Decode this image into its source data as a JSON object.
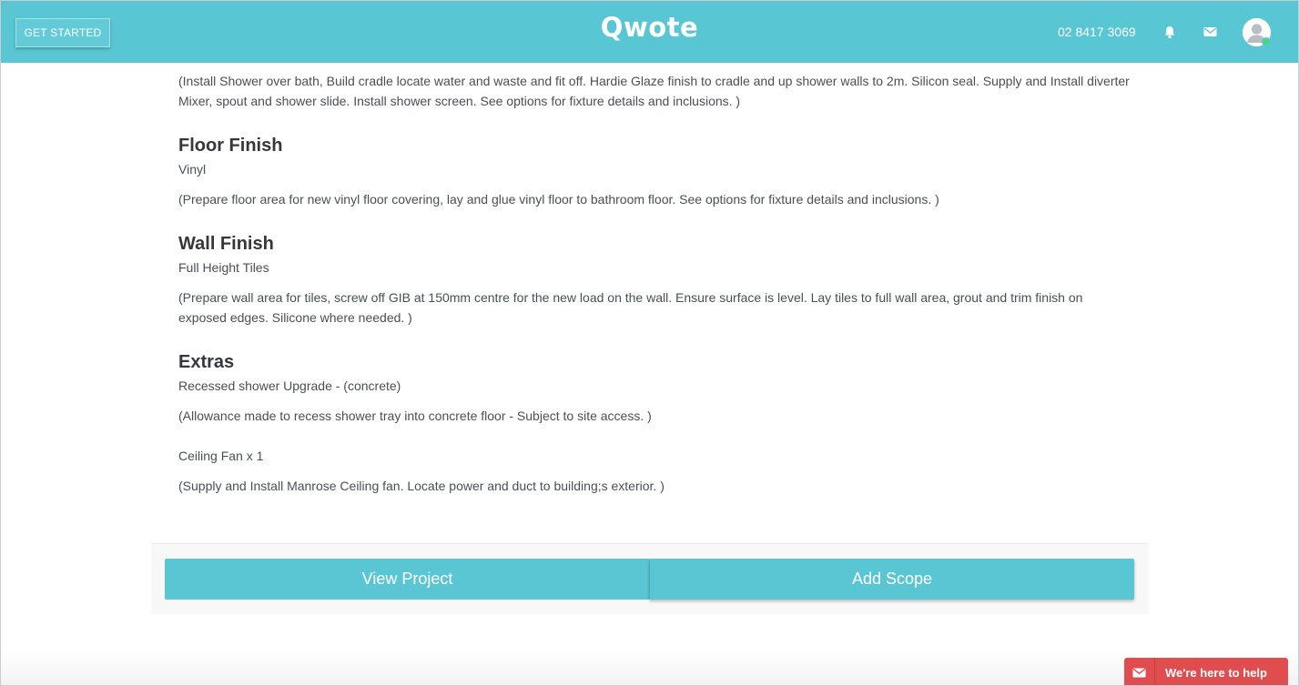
{
  "header": {
    "get_started": "GET STARTED",
    "logo": "Qwote",
    "phone": "02 8417 3069",
    "icons": [
      "bell-icon",
      "mail-icon",
      "user-avatar-icon"
    ]
  },
  "content": {
    "intro_desc": "(Install Shower over bath, Build cradle locate water and waste and fit off. Hardie Glaze finish to cradle and up shower walls to 2m. Silicon seal. Supply and Install diverter Mixer, spout and shower slide. Install shower screen. See options for fixture details and inclusions. )",
    "floor": {
      "title": "Floor Finish",
      "value": "Vinyl",
      "desc": "(Prepare floor area for new vinyl floor covering, lay and glue vinyl floor to bathroom floor. See options for fixture details and inclusions. )"
    },
    "wall": {
      "title": "Wall Finish",
      "value": "Full Height Tiles",
      "desc": "(Prepare wall area for tiles, screw off GIB at 150mm centre for the new load on the wall. Ensure surface is level. Lay tiles to full wall area, grout and trim finish on exposed edges. Silicone where needed. )"
    },
    "extras": {
      "title": "Extras",
      "items": [
        {
          "name": "Recessed shower Upgrade - (concrete)",
          "desc": "(Allowance made to recess shower tray into concrete floor - Subject to site access. )"
        },
        {
          "name": "Ceiling Fan x 1",
          "desc": "(Supply and Install Manrose Ceiling fan. Locate power and duct to building;s exterior. )"
        }
      ]
    }
  },
  "actions": {
    "view_project": "View Project",
    "add_scope": "Add Scope"
  },
  "help_widget": {
    "label": "We're here to help"
  },
  "colors": {
    "brand": "#59c6d3",
    "help": "#e14c4f",
    "online": "#4cd964"
  }
}
